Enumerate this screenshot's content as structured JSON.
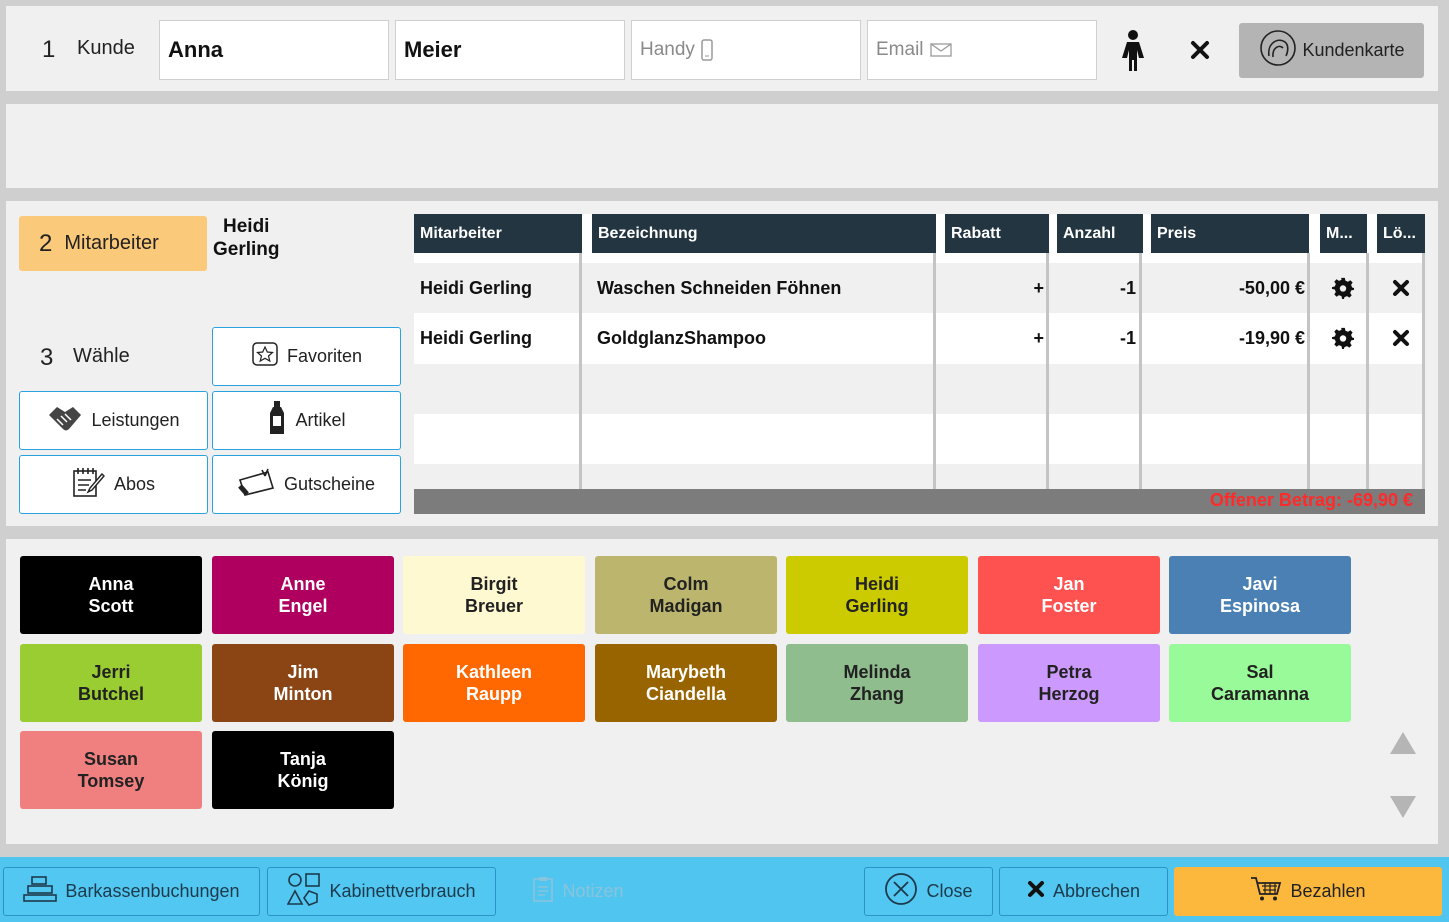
{
  "customer": {
    "step_number": "1",
    "step_label": "Kunde",
    "first_name": "Anna",
    "last_name": "Meier",
    "phone_placeholder": "Handy",
    "email_placeholder": "Email",
    "card_button": "Kundenkarte"
  },
  "employee": {
    "step_number": "2",
    "step_label": "Mitarbeiter",
    "selected_first": "Heidi",
    "selected_last": "Gerling"
  },
  "choose": {
    "step_number": "3",
    "step_label": "Wähle",
    "buttons": [
      "Favoriten",
      "Leistungen",
      "Artikel",
      "Abos",
      "Gutscheine"
    ]
  },
  "table": {
    "headers": [
      "Mitarbeiter",
      "Bezeichnung",
      "Rabatt",
      "Anzahl",
      "Preis",
      "M...",
      "Lö..."
    ],
    "rows": [
      {
        "employee": "Heidi Gerling",
        "description": "Waschen Schneiden Föhnen",
        "discount": "+",
        "quantity": "-1",
        "price": "-50,00 €"
      },
      {
        "employee": "Heidi Gerling",
        "description": "GoldglanzShampoo",
        "discount": "+",
        "quantity": "-1",
        "price": "-19,90 €"
      }
    ],
    "open_amount": "Offener Betrag: -69,90 €"
  },
  "staff": [
    {
      "first": "Anna",
      "last": "Scott",
      "color": "#000000",
      "text": "#ffffff"
    },
    {
      "first": "Anne",
      "last": "Engel",
      "color": "#b0005f",
      "text": "#ffffff"
    },
    {
      "first": "Birgit",
      "last": "Breuer",
      "color": "#fff9d2",
      "text": "#222222"
    },
    {
      "first": "Colm",
      "last": "Madigan",
      "color": "#bcb56d",
      "text": "#222222"
    },
    {
      "first": "Heidi",
      "last": "Gerling",
      "color": "#cbcb00",
      "text": "#222222"
    },
    {
      "first": "Jan",
      "last": "Foster",
      "color": "#fe5251",
      "text": "#ffffff"
    },
    {
      "first": "Javi",
      "last": "Espinosa",
      "color": "#4a80b4",
      "text": "#ffffff"
    },
    {
      "first": "Jerri",
      "last": "Butchel",
      "color": "#9acd32",
      "text": "#222222"
    },
    {
      "first": "Jim",
      "last": "Minton",
      "color": "#8b4514",
      "text": "#ffffff"
    },
    {
      "first": "Kathleen",
      "last": "Raupp",
      "color": "#ff6700",
      "text": "#ffffff"
    },
    {
      "first": "Marybeth",
      "last": "Ciandella",
      "color": "#986400",
      "text": "#ffffff"
    },
    {
      "first": "Melinda",
      "last": "Zhang",
      "color": "#8fbd8e",
      "text": "#222222"
    },
    {
      "first": "Petra",
      "last": "Herzog",
      "color": "#cc99fe",
      "text": "#222222"
    },
    {
      "first": "Sal",
      "last": "Caramanna",
      "color": "#98fa98",
      "text": "#222222"
    },
    {
      "first": "Susan",
      "last": "Tomsey",
      "color": "#f08080",
      "text": "#222222"
    },
    {
      "first": "Tanja",
      "last": "König",
      "color": "#000000",
      "text": "#ffffff"
    }
  ],
  "bottom": {
    "cash": "Barkassenbuchungen",
    "cabinet": "Kabinettverbrauch",
    "notes": "Notizen",
    "close": "Close",
    "cancel": "Abbrechen",
    "pay": "Bezahlen"
  }
}
